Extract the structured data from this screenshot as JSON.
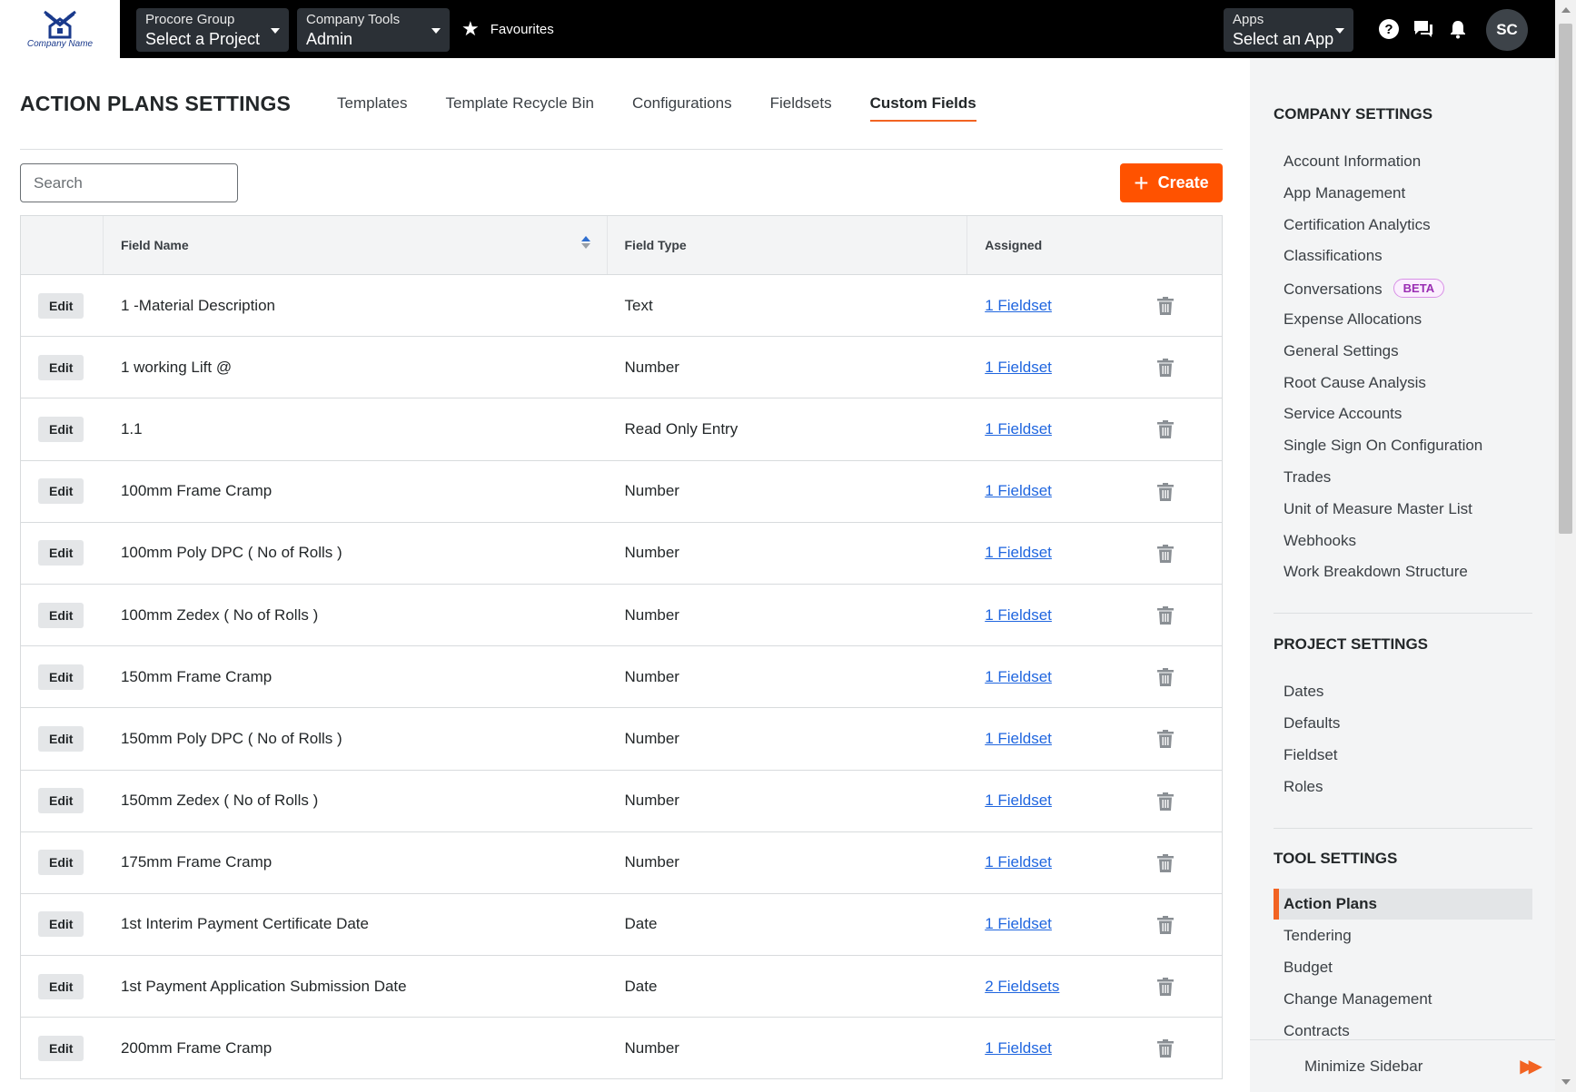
{
  "topbar": {
    "logo_text": "Company Name",
    "project_dd": {
      "label": "Procore Group",
      "value": "Select a Project"
    },
    "tools_dd": {
      "label": "Company Tools",
      "value": "Admin"
    },
    "favourites": "Favourites",
    "apps_dd": {
      "label": "Apps",
      "value": "Select an App"
    },
    "avatar": "SC"
  },
  "header": {
    "title": "ACTION PLANS SETTINGS",
    "tabs": [
      "Templates",
      "Template Recycle Bin",
      "Configurations",
      "Fieldsets",
      "Custom Fields"
    ],
    "active_tab": "Custom Fields"
  },
  "toolbar": {
    "search_placeholder": "Search",
    "create_label": "Create",
    "accent_color": "#ff5200"
  },
  "table": {
    "columns": [
      "Field Name",
      "Field Type",
      "Assigned"
    ],
    "edit_label": "Edit",
    "rows": [
      {
        "name": "1 -Material Description",
        "type": "Text",
        "assigned": "1 Fieldset"
      },
      {
        "name": "1 working Lift @",
        "type": "Number",
        "assigned": "1 Fieldset"
      },
      {
        "name": "1.1",
        "type": "Read Only Entry",
        "assigned": "1 Fieldset"
      },
      {
        "name": "100mm Frame Cramp",
        "type": "Number",
        "assigned": "1 Fieldset"
      },
      {
        "name": "100mm Poly DPC ( No of Rolls )",
        "type": "Number",
        "assigned": "1 Fieldset"
      },
      {
        "name": "100mm Zedex ( No of Rolls )",
        "type": "Number",
        "assigned": "1 Fieldset"
      },
      {
        "name": "150mm Frame Cramp",
        "type": "Number",
        "assigned": "1 Fieldset"
      },
      {
        "name": "150mm Poly DPC ( No of Rolls )",
        "type": "Number",
        "assigned": "1 Fieldset"
      },
      {
        "name": "150mm Zedex ( No of Rolls )",
        "type": "Number",
        "assigned": "1 Fieldset"
      },
      {
        "name": "175mm Frame Cramp",
        "type": "Number",
        "assigned": "1 Fieldset"
      },
      {
        "name": "1st Interim Payment Certificate Date",
        "type": "Date",
        "assigned": "1 Fieldset"
      },
      {
        "name": "1st Payment Application Submission Date",
        "type": "Date",
        "assigned": "2 Fieldsets"
      },
      {
        "name": "200mm Frame Cramp",
        "type": "Number",
        "assigned": "1 Fieldset"
      }
    ]
  },
  "sidebar": {
    "company_title": "COMPANY SETTINGS",
    "company_items": [
      "Account Information",
      "App Management",
      "Certification Analytics",
      "Classifications",
      "Conversations",
      "Expense Allocations",
      "General Settings",
      "Root Cause Analysis",
      "Service Accounts",
      "Single Sign On Configuration",
      "Trades",
      "Unit of Measure Master List",
      "Webhooks",
      "Work Breakdown Structure"
    ],
    "beta_badge": "BETA",
    "project_title": "PROJECT SETTINGS",
    "project_items": [
      "Dates",
      "Defaults",
      "Fieldset",
      "Roles"
    ],
    "tool_title": "TOOL SETTINGS",
    "tool_items": [
      "Action Plans",
      "Tendering",
      "Budget",
      "Change Management",
      "Contracts"
    ],
    "active_item": "Action Plans",
    "minimize": "Minimize Sidebar"
  }
}
